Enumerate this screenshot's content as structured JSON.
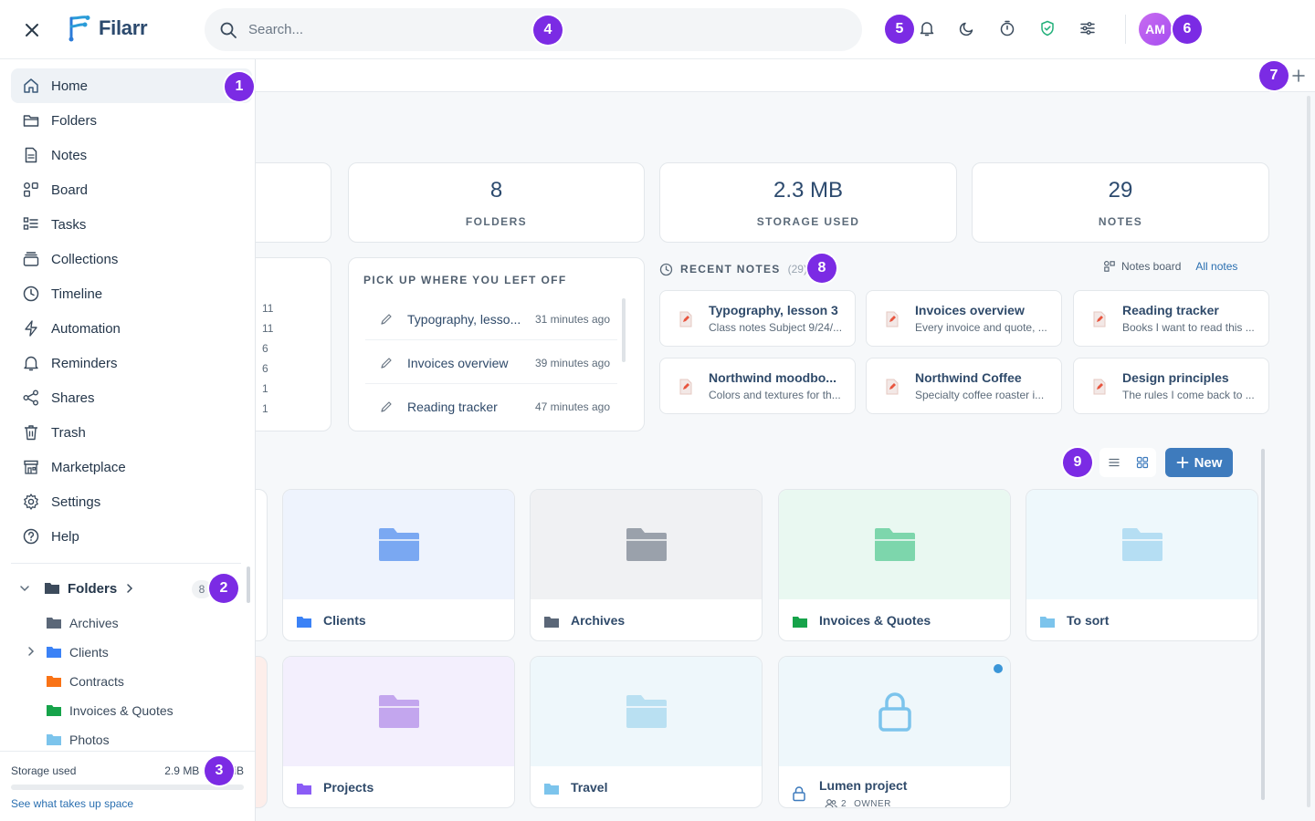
{
  "app": {
    "name": "Filarr"
  },
  "search": {
    "placeholder": "Search..."
  },
  "user": {
    "initials": "AM"
  },
  "sidebar": {
    "nav": [
      {
        "label": "Home",
        "icon": "home-icon"
      },
      {
        "label": "Folders",
        "icon": "folder-icon"
      },
      {
        "label": "Notes",
        "icon": "note-icon"
      },
      {
        "label": "Board",
        "icon": "board-icon"
      },
      {
        "label": "Tasks",
        "icon": "tasks-icon"
      },
      {
        "label": "Collections",
        "icon": "collections-icon"
      },
      {
        "label": "Timeline",
        "icon": "clock-icon"
      },
      {
        "label": "Automation",
        "icon": "bolt-icon"
      },
      {
        "label": "Reminders",
        "icon": "bell-icon"
      },
      {
        "label": "Shares",
        "icon": "share-icon"
      },
      {
        "label": "Trash",
        "icon": "trash-icon"
      },
      {
        "label": "Marketplace",
        "icon": "store-icon"
      },
      {
        "label": "Settings",
        "icon": "gear-icon"
      },
      {
        "label": "Help",
        "icon": "help-icon"
      }
    ],
    "tree": {
      "title": "Folders",
      "count": "8",
      "items": [
        {
          "label": "Archives",
          "color": "#5b6778"
        },
        {
          "label": "Clients",
          "color": "#3b82f6"
        },
        {
          "label": "Contracts",
          "color": "#f97316"
        },
        {
          "label": "Invoices & Quotes",
          "color": "#16a34a"
        },
        {
          "label": "Photos",
          "color": "#7cc4ec"
        }
      ]
    },
    "storage": {
      "label": "Storage used",
      "value": "2.9 MB o",
      "value_tail": "iB",
      "link": "See what takes up space"
    }
  },
  "stats": [
    {
      "value": "8",
      "label": "FOLDERS"
    },
    {
      "value": "2.3 MB",
      "label": "STORAGE USED"
    },
    {
      "value": "29",
      "label": "NOTES"
    }
  ],
  "left_partial_list": [
    "11",
    "11",
    "6",
    "6",
    "1",
    "1"
  ],
  "pickup": {
    "title": "PICK UP WHERE YOU LEFT OFF",
    "items": [
      {
        "name": "Typography, lesso...",
        "time": "31 minutes ago"
      },
      {
        "name": "Invoices overview",
        "time": "39 minutes ago"
      },
      {
        "name": "Reading tracker",
        "time": "47 minutes ago"
      }
    ]
  },
  "recent": {
    "title": "RECENT NOTES",
    "count": "(29)",
    "board_link": "Notes board",
    "all_link": "All notes",
    "notes": [
      {
        "title": "Typography, lesson 3",
        "sub": "Class notes Subject 9/24/..."
      },
      {
        "title": "Invoices overview",
        "sub": "Every invoice and quote, ..."
      },
      {
        "title": "Reading tracker",
        "sub": "Books I want to read this ..."
      },
      {
        "title": "Northwind moodbo...",
        "sub": "Colors and textures for th..."
      },
      {
        "title": "Northwind Coffee",
        "sub": "Specialty coffee roaster i..."
      },
      {
        "title": "Design principles",
        "sub": "The rules I come back to ..."
      }
    ]
  },
  "toolbar": {
    "new_label": "New"
  },
  "folders": [
    {
      "name": "Clients",
      "bg": "#eef3fd",
      "color": "#7aa8f2"
    },
    {
      "name": "Archives",
      "bg": "#f0f1f3",
      "color": "#9aa1ab"
    },
    {
      "name": "Invoices & Quotes",
      "bg": "#e9f8f1",
      "color": "#7dd6ac"
    },
    {
      "name": "To sort",
      "bg": "#eef8fc",
      "color": "#b5def3"
    },
    {
      "name": "Projects",
      "bg": "#f3effd",
      "color": "#c3a6ee"
    },
    {
      "name": "Travel",
      "bg": "#eef7fb",
      "color": "#b9e0f2"
    }
  ],
  "lumen": {
    "name": "Lumen project",
    "members": "2",
    "role": "OWNER"
  },
  "badges": [
    "1",
    "2",
    "3",
    "4",
    "5",
    "6",
    "7",
    "8",
    "9"
  ]
}
